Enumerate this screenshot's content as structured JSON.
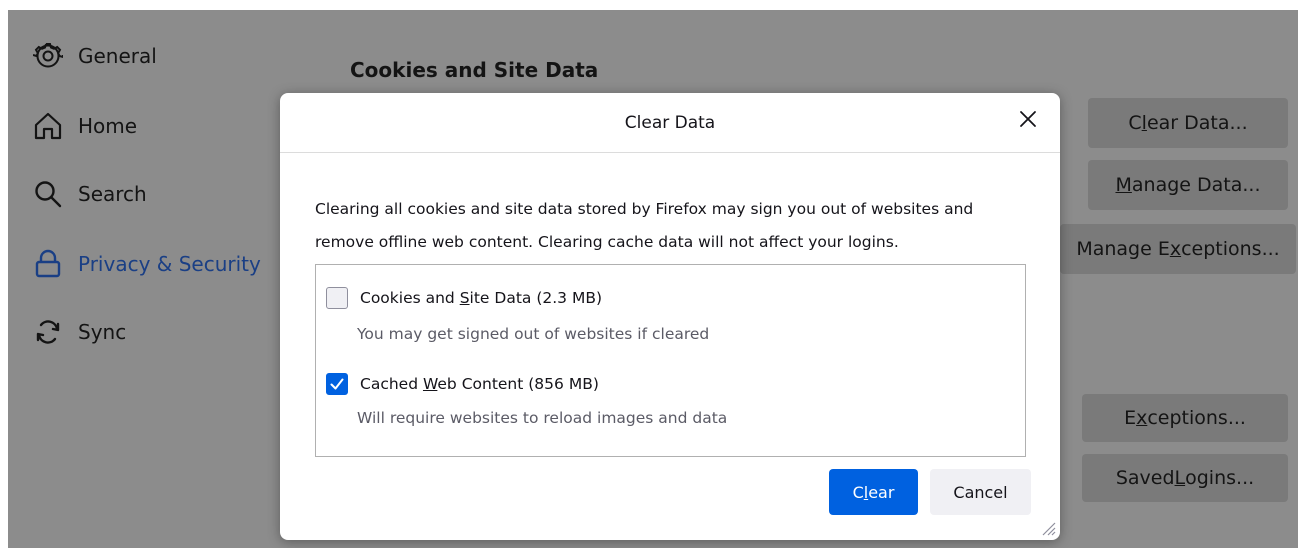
{
  "sidebar": {
    "items": [
      {
        "label": "General",
        "icon": "gear-icon"
      },
      {
        "label": "Home",
        "icon": "home-icon"
      },
      {
        "label": "Search",
        "icon": "search-icon"
      },
      {
        "label": "Privacy & Security",
        "icon": "lock-icon",
        "selected": true
      },
      {
        "label": "Sync",
        "icon": "sync-icon"
      }
    ]
  },
  "section": {
    "title": "Cookies and Site Data"
  },
  "background_buttons": {
    "clear_data_pre": "C",
    "clear_data_ul": "l",
    "clear_data_post": "ear Data...",
    "manage_data_ul": "M",
    "manage_data_post": "anage Data...",
    "manage_exceptions_pre": "Manage E",
    "manage_exceptions_ul": "x",
    "manage_exceptions_post": "ceptions...",
    "exceptions_pre": "E",
    "exceptions_ul": "x",
    "exceptions_post": "ceptions...",
    "saved_logins_pre": "Saved ",
    "saved_logins_ul": "L",
    "saved_logins_post": "ogins..."
  },
  "dialog": {
    "title": "Clear Data",
    "description_line1": "Clearing all cookies and site data stored by Firefox may sign you out of websites and",
    "description_line2": "remove offline web content. Clearing cache data will not affect your logins.",
    "options": [
      {
        "label_pre": "Cookies and ",
        "label_ul": "S",
        "label_post": "ite Data (2.3 MB)",
        "sub": "You may get signed out of websites if cleared",
        "checked": false
      },
      {
        "label_pre": "Cached ",
        "label_ul": "W",
        "label_post": "eb Content (856 MB)",
        "sub": "Will require websites to reload images and data",
        "checked": true
      }
    ],
    "clear_pre": "C",
    "clear_ul": "l",
    "clear_post": "ear",
    "cancel_label": "Cancel"
  },
  "colors": {
    "accent": "#0061e0",
    "backdrop": "#8c8c8c",
    "selected_nav": "#1a3f85"
  }
}
